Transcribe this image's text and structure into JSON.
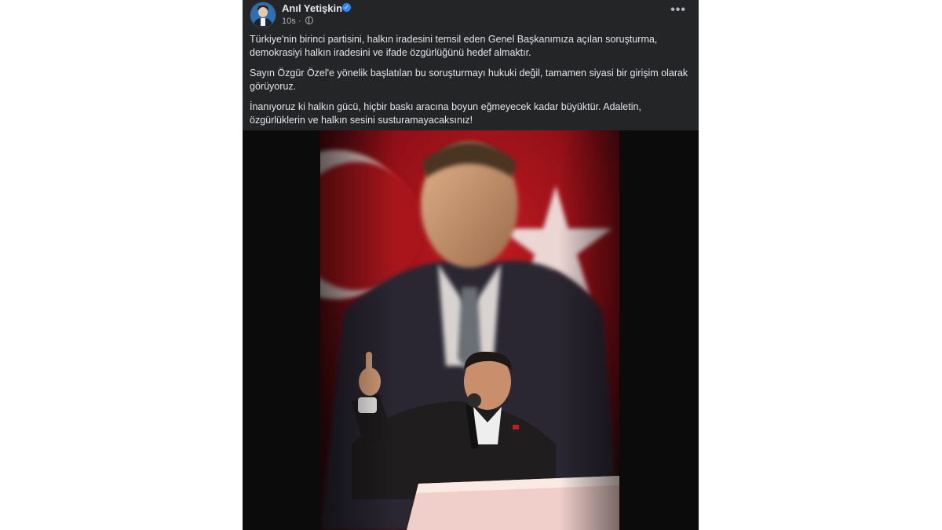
{
  "post": {
    "author": "Anıl Yetişkin",
    "time": "10s",
    "separator": "·",
    "more_label": "•••",
    "paragraphs": [
      "Türkiye'nin birinci partisini, halkın iradesini temsil eden Genel Başkanımıza açılan soruşturma, demokrasiyi halkın iradesini ve ifade özgürlüğünü hedef almaktır.",
      "Sayın Özgür Özel'e yönelik başlatılan bu soruşturmayı hukuki değil, tamamen siyasi bir girişim olarak görüyoruz.",
      "İnanıyoruz ki halkın gücü, hiçbir baskı aracına boyun eğmeyecek kadar büyüktür. Adaletin, özgürlüklerin ve halkın sesini susturamayacaksınız!"
    ]
  },
  "icons": {
    "verified": "verified-badge-icon",
    "privacy": "globe-icon",
    "more": "more-options-icon"
  },
  "colors": {
    "card_background": "#242526",
    "primary_text": "#e4e6eb",
    "secondary_text": "#b0b3b8",
    "verified_blue": "#2d88ff",
    "flag_red": "#b5121b"
  }
}
